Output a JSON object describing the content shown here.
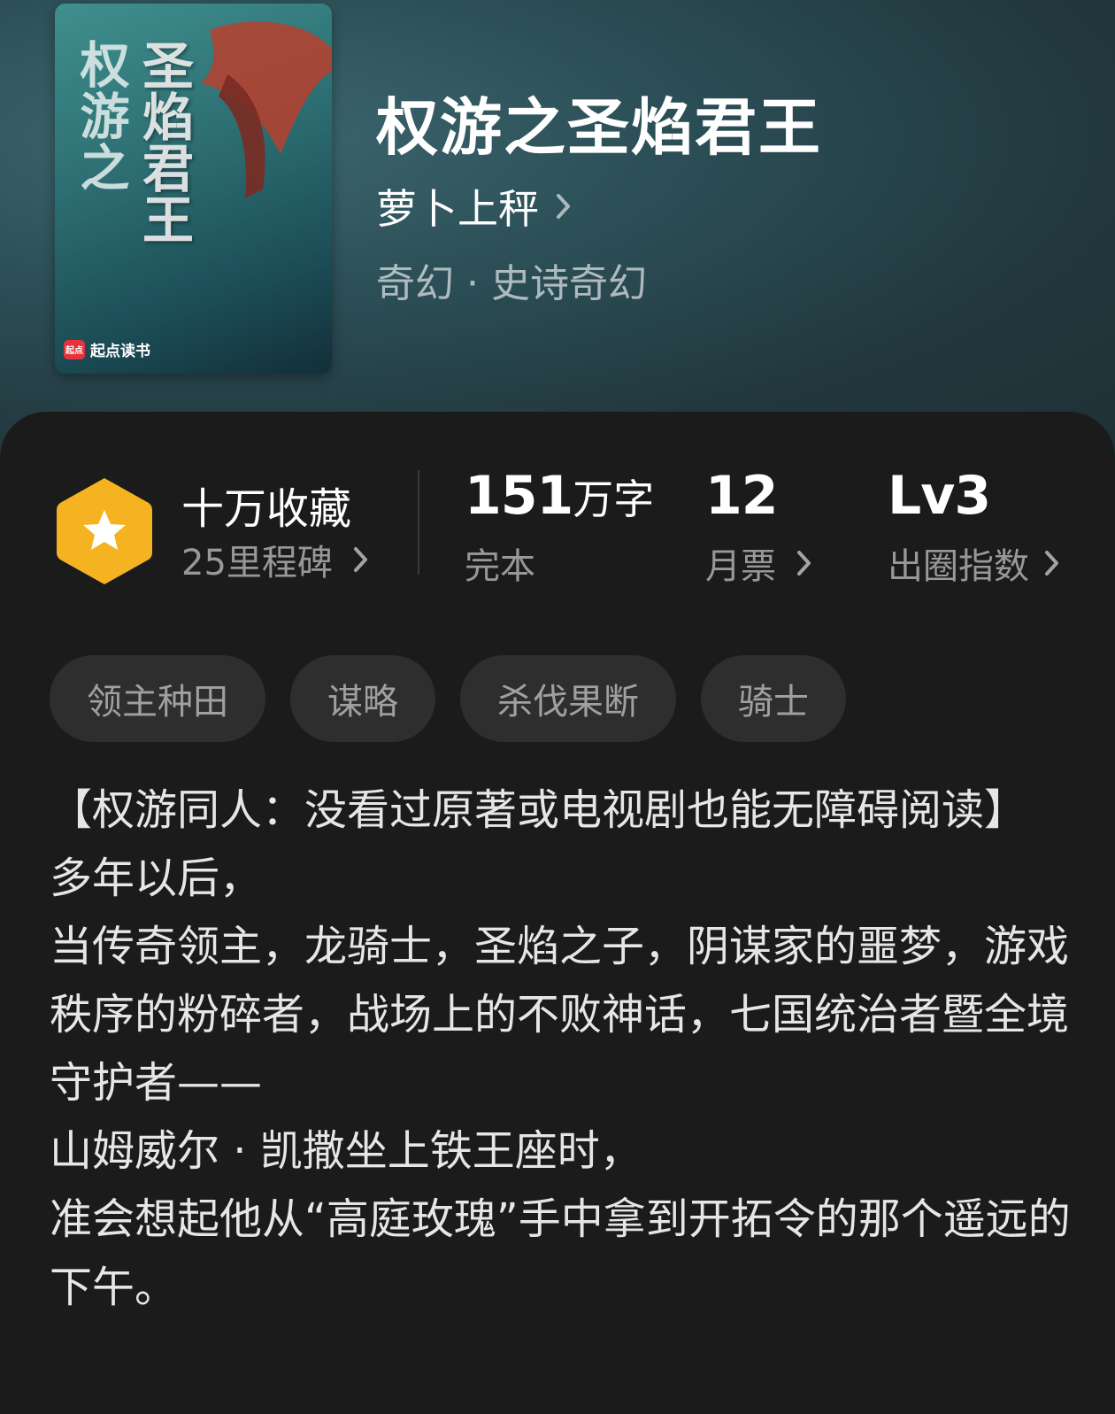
{
  "book": {
    "title": "权游之圣焰君王",
    "author": "萝卜上秤",
    "genre": "奇幻 · 史诗奇幻",
    "cover": {
      "title_left": "权游之",
      "title_right": "圣焰君王",
      "publisher": "起点读书",
      "publisher_mark": "起点"
    }
  },
  "stats": {
    "collect": {
      "label": "十万收藏",
      "sub": "25里程碑"
    },
    "words": {
      "number": "151",
      "unit": "万字",
      "sub": "完本"
    },
    "tickets": {
      "number": "12",
      "sub": "月票"
    },
    "level": {
      "number": "Lv3",
      "sub": "出圈指数"
    }
  },
  "tags": [
    "领主种田",
    "谋略",
    "杀伐果断",
    "骑士"
  ],
  "description": "【权游同人：没看过原著或电视剧也能无障碍阅读】\n多年以后，\n当传奇领主，龙骑士，圣焰之子，阴谋家的噩梦，游戏秩序的粉碎者，战场上的不败神话，七国统治者暨全境守护者——\n山姆威尔 · 凯撒坐上铁王座时，\n准会想起他从“高庭玫瑰”手中拿到开拓令的那个遥远的下午。",
  "icons": {
    "collect": "star-hexagon-icon",
    "arrow": "chevron-right-icon"
  },
  "colors": {
    "header_bg": "#2c4f57",
    "card_bg": "#1b1b1c",
    "tag_bg": "#2e2e2f",
    "badge": "#f5b321"
  }
}
